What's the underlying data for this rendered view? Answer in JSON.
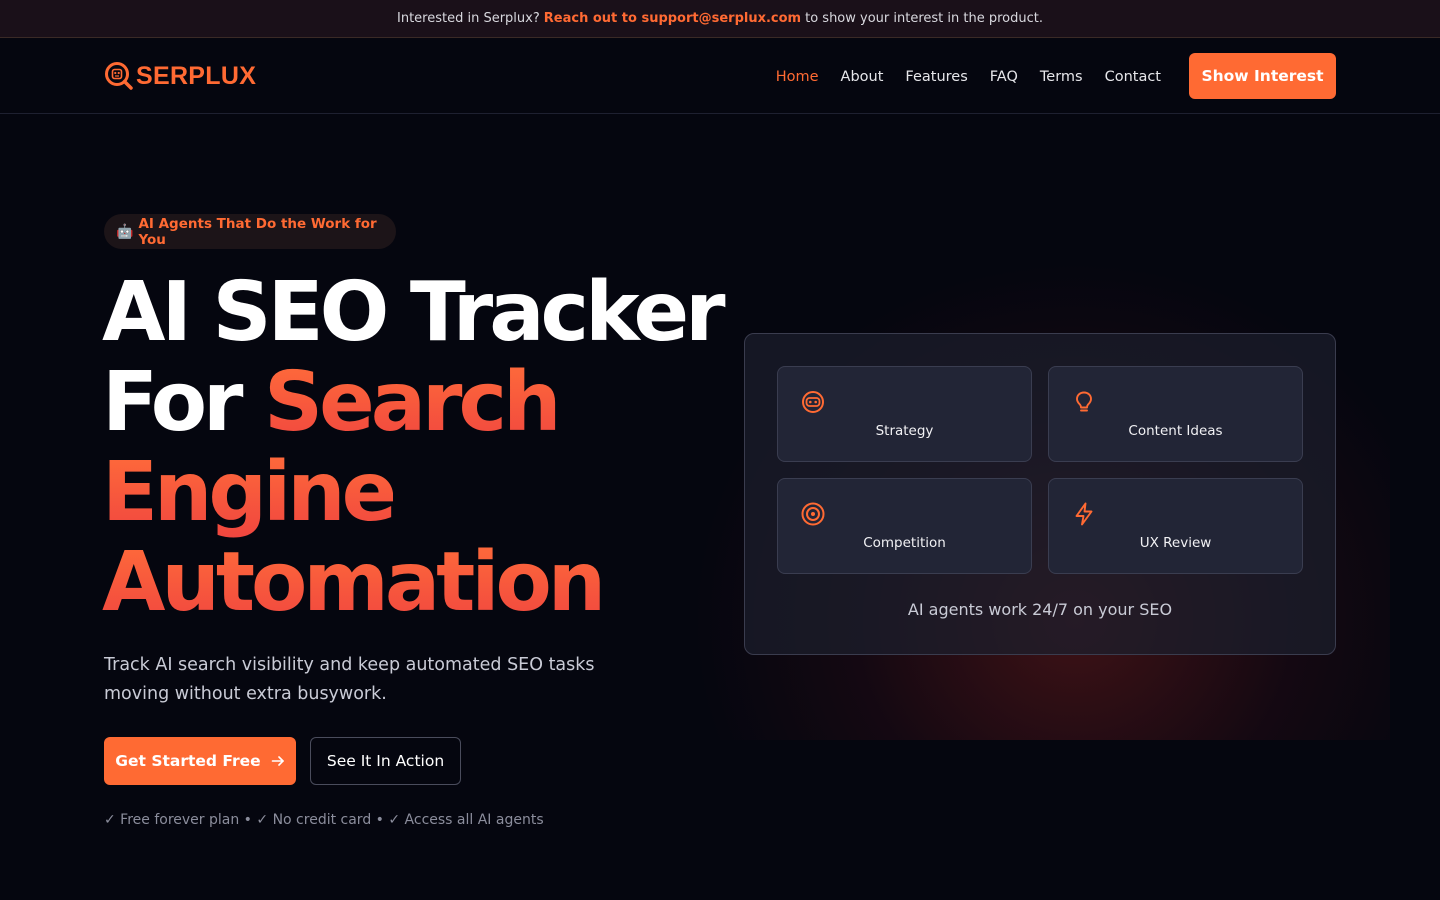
{
  "announcement": {
    "prefix": "Interested in Serplux?",
    "highlight": "Reach out to support@serplux.com",
    "suffix": "to show your interest in the product."
  },
  "brand": {
    "name": "SERPLUX",
    "accent": "#ff6a33"
  },
  "nav": {
    "items": [
      {
        "label": "Home",
        "active": true
      },
      {
        "label": "About",
        "active": false
      },
      {
        "label": "Features",
        "active": false
      },
      {
        "label": "FAQ",
        "active": false
      },
      {
        "label": "Terms",
        "active": false
      },
      {
        "label": "Contact",
        "active": false
      }
    ],
    "cta_label": "Show Interest"
  },
  "hero": {
    "badge_icon": "robot-icon",
    "badge_label": "AI Agents That Do the Work for You",
    "headline": {
      "line1": "AI SEO Tracker",
      "line2_white": "For",
      "line2_orange": "Search",
      "line3": "Engine",
      "line4": "Automation"
    },
    "subtitle": "Track AI search visibility and keep automated SEO tasks moving without extra busywork.",
    "primary_cta": "Get Started Free",
    "secondary_cta": "See It In Action",
    "perks": "✓ Free forever plan • ✓ No credit card • ✓ Access all AI agents"
  },
  "agents_panel": {
    "cards": [
      {
        "label": "Strategy",
        "icon": "bot-icon"
      },
      {
        "label": "Content Ideas",
        "icon": "lightbulb-icon"
      },
      {
        "label": "Competition",
        "icon": "target-icon"
      },
      {
        "label": "UX Review",
        "icon": "lightning-icon"
      }
    ],
    "footer": "AI agents work 24/7 on your SEO"
  }
}
